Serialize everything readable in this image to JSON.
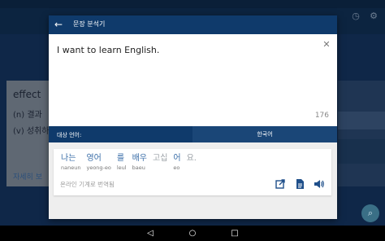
{
  "background": {
    "word": "effect",
    "definitions": [
      "(n) 결과",
      "(v) 성취하"
    ],
    "more_link": "자세히 보"
  },
  "dialog": {
    "title": "문장 분석기",
    "input_text": "I want to learn English.",
    "char_count": "176",
    "target_language_label": "대상 언어:",
    "target_language_value": "한국어",
    "tokens": [
      {
        "kr": "나는",
        "rom": "naneun",
        "gray": false
      },
      {
        "kr": "영어",
        "rom": "yeong-eo",
        "gray": false
      },
      {
        "kr": "를",
        "rom": "leul",
        "gray": false
      },
      {
        "kr": "배우",
        "rom": "baeu",
        "gray": false
      },
      {
        "kr": "고십",
        "rom": "",
        "gray": true
      },
      {
        "kr": "어",
        "rom": "eo",
        "gray": false
      },
      {
        "kr": "요.",
        "rom": "",
        "gray": true
      }
    ],
    "translation_note": "온라인 기계로 번역됨"
  },
  "icons": {
    "back": "arrow-back-icon",
    "close": "close-icon",
    "edit": "open-in-new-icon",
    "document": "document-icon",
    "speaker": "speaker-icon",
    "history": "history-icon",
    "settings": "settings-icon",
    "search": "search-icon"
  },
  "colors": {
    "header": "#0f3a6b",
    "accent_text": "#3b6ea8"
  }
}
